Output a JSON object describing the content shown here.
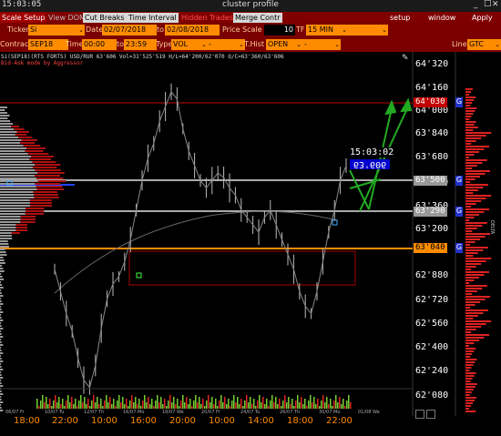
{
  "titlebar": {
    "clock": "15:03:05",
    "title": "cluster profile"
  },
  "menubar": {
    "tabs": [
      "Scale Setup",
      "View DOM",
      "Cut Breaks",
      "Time Interval",
      "Hidden Trades",
      "Merge Contr"
    ],
    "right": [
      "setup",
      "window",
      "Apply"
    ]
  },
  "params1": {
    "ticker_label": "Ticker",
    "ticker_value": "Si",
    "date_label": "Date",
    "date_from": "02/07/2018",
    "to_label": "to",
    "date_to": "02/08/2018",
    "price_scale_label": "Price Scale",
    "price_scale_value": "10",
    "tf_label": "TF",
    "tf_value": "15 MIN"
  },
  "params2": {
    "contract_label": "Contract",
    "contract_value": "SEP18",
    "time_label": "Time",
    "time_from": "00:00",
    "time_to_label": "to",
    "time_to": "23:59",
    "type_label": "Type",
    "type_value": "VOL",
    "type_extra": "-",
    "thist_label": "T.Hist",
    "thist_value": "OPEN",
    "thist_extra": "-",
    "line_label": "Line",
    "line_value": "GTC"
  },
  "chart": {
    "info_line": "Si(SEP18)(RTS FORTS) USD/RUR  63'606  Vol=31'525'519 H/L=64'200/62'070 O/C=63'360/63'606",
    "bid_ask_line": "Bid-Ask mode by Aggressor",
    "price_labels": [
      "64'320",
      "64'160",
      "64'000",
      "63'840",
      "63'680",
      "63'520",
      "63'360",
      "63'200",
      "62'880",
      "62'720",
      "62'560",
      "62'400",
      "62'240",
      "62'080"
    ],
    "level_high": "64'030",
    "level_500": "63'500",
    "level_290": "63'290",
    "level_040": "63'040",
    "current_price": "63'606",
    "current_time": "15:03:02",
    "g_marker": "G",
    "side_label": "DELTA",
    "time_labels": [
      "18:00",
      "22:00",
      "10:00",
      "16:00",
      "20:00",
      "10:00",
      "14:00",
      "18:00",
      "22:00"
    ],
    "date_ticks": [
      "06/07 Fr",
      "10/07 Tu",
      "12/07 Th",
      "16/07 Mo",
      "18/07 We",
      "20/07 Fr",
      "24/07 Tu",
      "26/07 Th",
      "30/07 Mo",
      "01/08 We"
    ],
    "close_series": [
      62900,
      62750,
      62600,
      62480,
      62300,
      62150,
      62100,
      62250,
      62500,
      62700,
      62800,
      62850,
      62950,
      63100,
      63300,
      63500,
      63650,
      63750,
      63900,
      64000,
      64100,
      64050,
      63850,
      63700,
      63600,
      63500,
      63450,
      63500,
      63550,
      63520,
      63450,
      63400,
      63300,
      63250,
      63200,
      63150,
      63250,
      63300,
      63200,
      63100,
      63000,
      62900,
      62750,
      62650,
      62600,
      62750,
      62950,
      63150,
      63300,
      63500,
      63600
    ]
  },
  "colors": {
    "menubar": "#800000",
    "field": "#ff8c00",
    "level_high": "#c00000",
    "level_orange": "#ff8c00",
    "level_gray": "#aaaaaa",
    "current_blue": "#0000cc",
    "arrow_green": "#22aa22"
  }
}
